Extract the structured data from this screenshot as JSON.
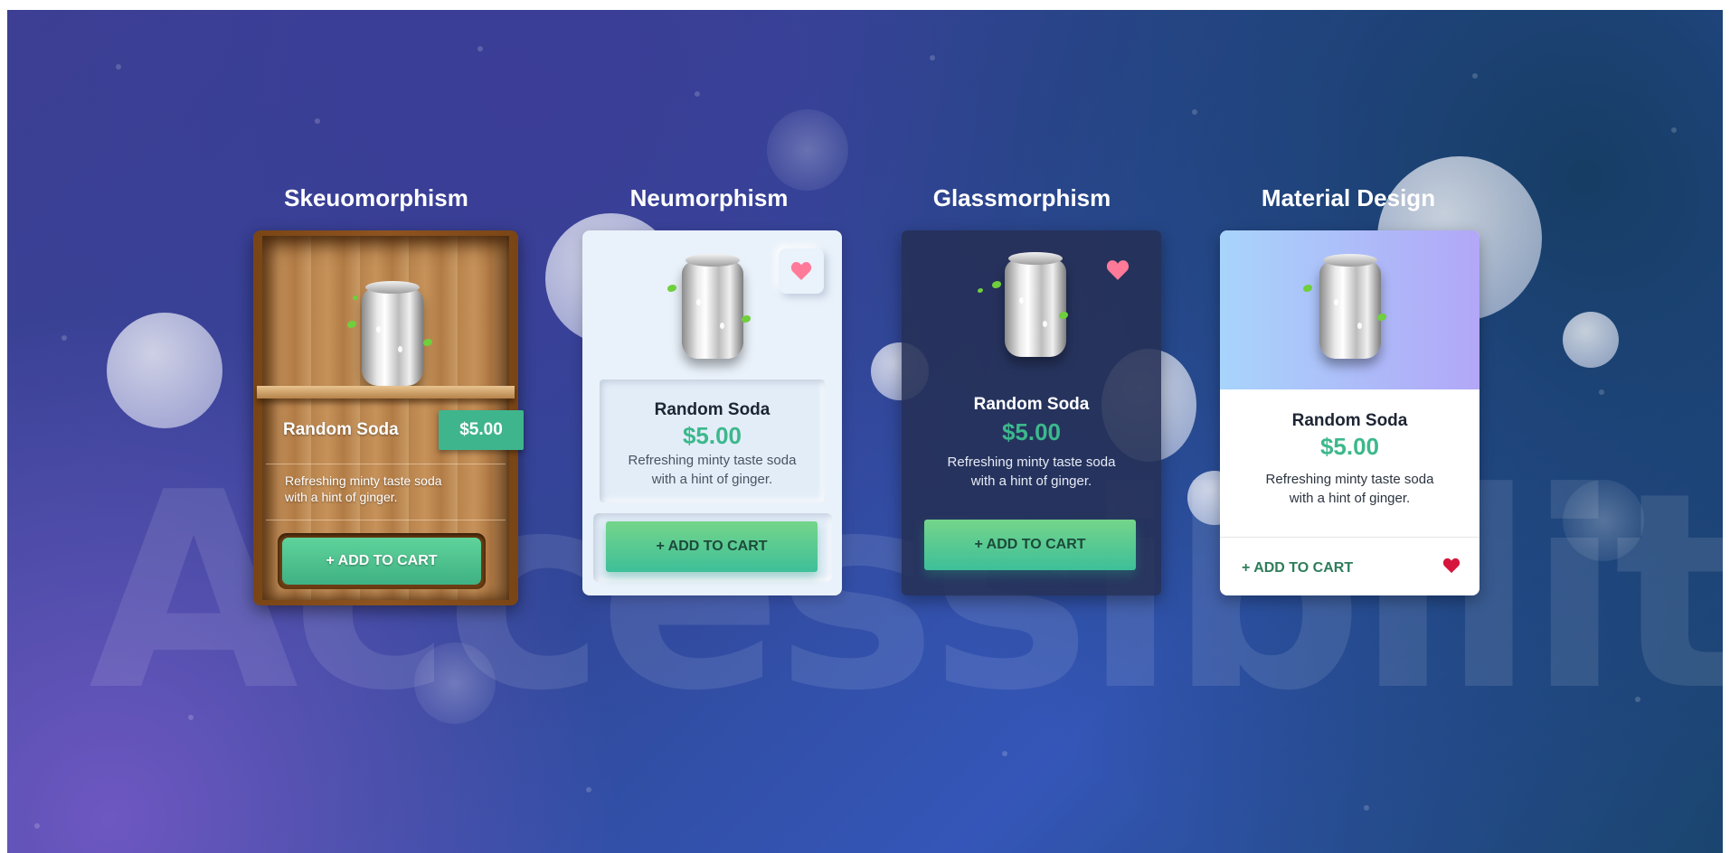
{
  "watermark": "Accessibility",
  "colors": {
    "accent_green": "#3db88c",
    "heart_pink": "#ff7a98",
    "heart_red": "#d6153c",
    "wood": "#b8834c"
  },
  "cards": [
    {
      "style_title": "Skeuomorphism",
      "name": "Random Soda",
      "price": "$5.00",
      "description_line1": "Refreshing minty taste soda",
      "description_line2": "with a hint of ginger.",
      "cta": "+ ADD TO CART"
    },
    {
      "style_title": "Neumorphism",
      "name": "Random Soda",
      "price": "$5.00",
      "description_line1": "Refreshing minty taste soda",
      "description_line2": "with a hint of ginger.",
      "cta": "+ ADD TO CART",
      "icon": "heart-icon"
    },
    {
      "style_title": "Glassmorphism",
      "name": "Random Soda",
      "price": "$5.00",
      "description_line1": "Refreshing minty taste soda",
      "description_line2": "with a hint of ginger.",
      "cta": "+ ADD TO CART",
      "icon": "heart-icon"
    },
    {
      "style_title": "Material Design",
      "name": "Random Soda",
      "price": "$5.00",
      "description_line1": "Refreshing minty taste soda",
      "description_line2": "with a hint of ginger.",
      "cta": "+ ADD TO CART",
      "icon": "heart-icon"
    }
  ]
}
